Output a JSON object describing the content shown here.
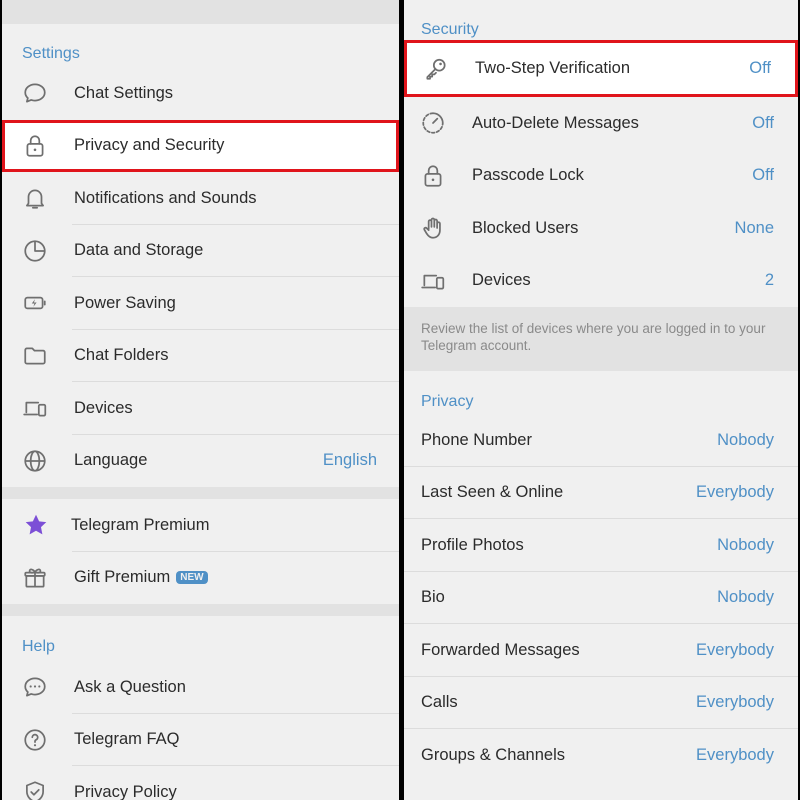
{
  "left": {
    "settings_title": "Settings",
    "settings_items": [
      {
        "label": "Chat Settings",
        "icon": "chat-bubble-icon"
      },
      {
        "label": "Privacy and Security",
        "icon": "lock-icon"
      },
      {
        "label": "Notifications and Sounds",
        "icon": "bell-icon"
      },
      {
        "label": "Data and Storage",
        "icon": "pie-chart-icon"
      },
      {
        "label": "Power Saving",
        "icon": "battery-bolt-icon"
      },
      {
        "label": "Chat Folders",
        "icon": "folder-icon"
      },
      {
        "label": "Devices",
        "icon": "devices-icon"
      },
      {
        "label": "Language",
        "value": "English",
        "icon": "globe-icon"
      }
    ],
    "premium_items": [
      {
        "label": "Telegram Premium",
        "icon": "star-icon"
      },
      {
        "label": "Gift Premium",
        "badge": "NEW",
        "icon": "gift-icon"
      }
    ],
    "help_title": "Help",
    "help_items": [
      {
        "label": "Ask a Question",
        "icon": "chat-dots-icon"
      },
      {
        "label": "Telegram FAQ",
        "icon": "question-icon"
      },
      {
        "label": "Privacy Policy",
        "icon": "shield-check-icon"
      }
    ]
  },
  "right": {
    "security_title": "Security",
    "security_items": [
      {
        "label": "Two-Step Verification",
        "value": "Off",
        "icon": "key-icon"
      },
      {
        "label": "Auto-Delete Messages",
        "value": "Off",
        "icon": "timer-icon"
      },
      {
        "label": "Passcode Lock",
        "value": "Off",
        "icon": "lock-icon"
      },
      {
        "label": "Blocked Users",
        "value": "None",
        "icon": "hand-icon"
      },
      {
        "label": "Devices",
        "value": "2",
        "icon": "devices-icon"
      }
    ],
    "devices_hint": "Review the list of devices where you are logged in to your Telegram account.",
    "privacy_title": "Privacy",
    "privacy_items": [
      {
        "label": "Phone Number",
        "value": "Nobody"
      },
      {
        "label": "Last Seen & Online",
        "value": "Everybody"
      },
      {
        "label": "Profile Photos",
        "value": "Nobody"
      },
      {
        "label": "Bio",
        "value": "Nobody"
      },
      {
        "label": "Forwarded Messages",
        "value": "Everybody"
      },
      {
        "label": "Calls",
        "value": "Everybody"
      },
      {
        "label": "Groups & Channels",
        "value": "Everybody"
      }
    ]
  },
  "colors": {
    "accent": "#4f90c6",
    "highlight_border": "#e0141b",
    "premium_star": "#7c4fd6"
  }
}
